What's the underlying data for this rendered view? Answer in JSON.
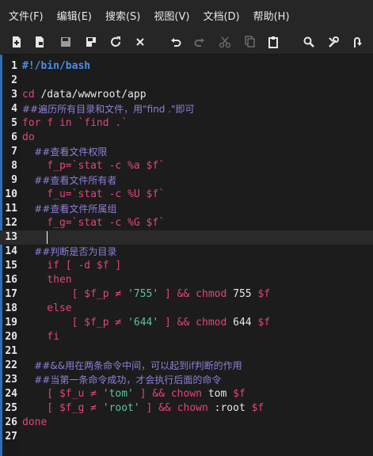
{
  "menu": [
    "文件(F)",
    "编辑(E)",
    "搜索(S)",
    "视图(V)",
    "文档(D)",
    "帮助(H)"
  ],
  "toolbar_icons": [
    "new-file-icon",
    "open-file-icon",
    "save-icon",
    "save-all-icon",
    "reload-icon",
    "close-icon",
    "undo-icon",
    "redo-icon",
    "cut-icon",
    "copy-icon",
    "paste-icon",
    "search-icon",
    "tools-icon",
    "jump-icon"
  ],
  "colors": {
    "keyword": "#e0457b",
    "shebang": "#4a8ee8",
    "comment": "#8f7fd9",
    "string": "#59c4a3",
    "variable": "#e0457b",
    "plain": "#e8e8e8",
    "gutter_accent": "#2c6eb8"
  },
  "current_line": 13,
  "editor": {
    "lines": [
      [
        {
          "t": "#!/bin/bash",
          "c": "shebang",
          "b": 1
        }
      ],
      [],
      [
        {
          "t": "cd ",
          "c": "keyword"
        },
        {
          "t": "/data/wwwroot/app",
          "c": "plain"
        }
      ],
      [
        {
          "t": "##遍历所有目录和文件，用\"find .\"即可",
          "c": "comment",
          "cm": 1
        }
      ],
      [
        {
          "t": "for ",
          "c": "keyword"
        },
        {
          "t": "f ",
          "c": "keyword"
        },
        {
          "t": "in ",
          "c": "keyword"
        },
        {
          "t": "`find .`",
          "c": "keyword"
        }
      ],
      [
        {
          "t": "do",
          "c": "keyword"
        }
      ],
      [
        {
          "t": "    ##查看文件权限",
          "c": "comment",
          "cm": 1
        }
      ],
      [
        {
          "t": "    f_p=",
          "c": "keyword"
        },
        {
          "t": "`stat -c %a $f`",
          "c": "keyword"
        }
      ],
      [
        {
          "t": "    ##查看文件所有者",
          "c": "comment",
          "cm": 1
        }
      ],
      [
        {
          "t": "    f_u=",
          "c": "keyword"
        },
        {
          "t": "`stat -c %U $f`",
          "c": "keyword"
        }
      ],
      [
        {
          "t": "    ##查看文件所属组",
          "c": "comment",
          "cm": 1
        }
      ],
      [
        {
          "t": "    f_g=",
          "c": "keyword"
        },
        {
          "t": "`stat -c %G $f`",
          "c": "keyword"
        }
      ],
      [],
      [
        {
          "t": "    ##判断是否为目录",
          "c": "comment",
          "cm": 1
        }
      ],
      [
        {
          "t": "    if [ -d $f ]",
          "c": "keyword"
        }
      ],
      [
        {
          "t": "    then",
          "c": "keyword"
        }
      ],
      [
        {
          "t": "        [ $f_p ≠ ",
          "c": "keyword"
        },
        {
          "t": "'755'",
          "c": "string"
        },
        {
          "t": " ] && chmod ",
          "c": "keyword"
        },
        {
          "t": "755 ",
          "c": "plain"
        },
        {
          "t": "$f",
          "c": "keyword"
        }
      ],
      [
        {
          "t": "    else",
          "c": "keyword"
        }
      ],
      [
        {
          "t": "        [ $f_p ≠ ",
          "c": "keyword"
        },
        {
          "t": "'644'",
          "c": "string"
        },
        {
          "t": " ] && chmod ",
          "c": "keyword"
        },
        {
          "t": "644 ",
          "c": "plain"
        },
        {
          "t": "$f",
          "c": "keyword"
        }
      ],
      [
        {
          "t": "    fi",
          "c": "keyword"
        }
      ],
      [],
      [
        {
          "t": "    ##&&用在两条命令中间，可以起到if判断的作用",
          "c": "comment",
          "cm": 1
        }
      ],
      [
        {
          "t": "    ##当第一条命令成功，才会执行后面的命令",
          "c": "comment",
          "cm": 1
        }
      ],
      [
        {
          "t": "    [ $f_u ≠ ",
          "c": "keyword"
        },
        {
          "t": "'tom'",
          "c": "string"
        },
        {
          "t": " ] && chown ",
          "c": "keyword"
        },
        {
          "t": "tom ",
          "c": "plain"
        },
        {
          "t": "$f",
          "c": "keyword"
        }
      ],
      [
        {
          "t": "    [ $f_g ≠ ",
          "c": "keyword"
        },
        {
          "t": "'root'",
          "c": "string"
        },
        {
          "t": " ] && chown ",
          "c": "keyword"
        },
        {
          "t": ":root ",
          "c": "plain"
        },
        {
          "t": "$f",
          "c": "keyword"
        }
      ],
      [
        {
          "t": "done",
          "c": "keyword"
        }
      ],
      []
    ]
  }
}
